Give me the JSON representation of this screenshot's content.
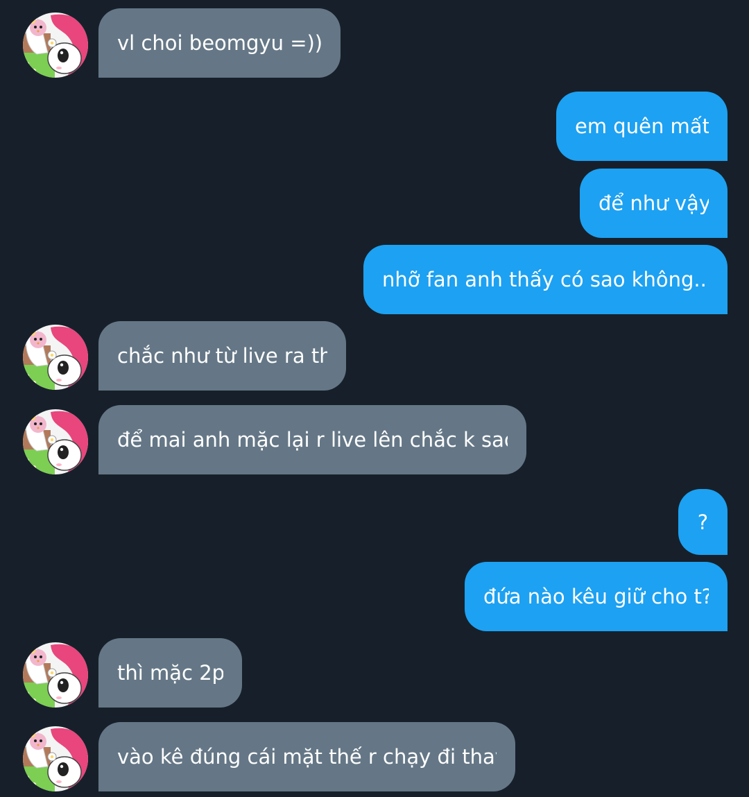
{
  "conversation": {
    "messages": [
      {
        "direction": "incoming",
        "text": "vl choi beomgyu =)))",
        "avatar": "my-melody-avatar"
      },
      {
        "direction": "outgoing",
        "text": "em quên mất"
      },
      {
        "direction": "outgoing",
        "text": "để như vậy"
      },
      {
        "direction": "outgoing",
        "text": "nhỡ fan anh thấy có sao không..."
      },
      {
        "direction": "incoming",
        "text": "chắc như từ live ra th",
        "avatar": "my-melody-avatar"
      },
      {
        "direction": "incoming",
        "text": "để mai anh mặc lại r live lên chắc k sao",
        "avatar": "my-melody-avatar"
      },
      {
        "direction": "outgoing",
        "text": "?"
      },
      {
        "direction": "outgoing",
        "text": "đứa nào kêu giữ cho t?"
      },
      {
        "direction": "incoming",
        "text": "thì mặc 2p",
        "avatar": "my-melody-avatar"
      },
      {
        "direction": "incoming",
        "text": "vào kê đúng cái mặt thế r chạy đi thay",
        "avatar": "my-melody-avatar"
      }
    ]
  },
  "colors": {
    "background": "#17202a",
    "incoming_bubble": "#657786",
    "outgoing_bubble": "#1da1f2",
    "text": "#ffffff"
  }
}
